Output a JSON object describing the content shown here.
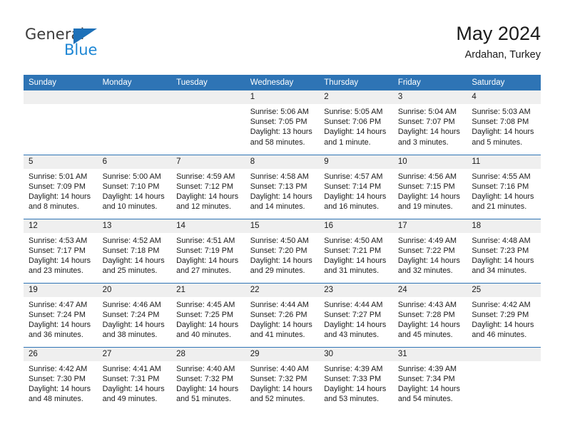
{
  "brand": {
    "name_top": "General",
    "name_bottom": "Blue",
    "triangle_icon": "triangle-icon",
    "accent_color": "#1d86d4"
  },
  "header": {
    "title": "May 2024",
    "subtitle": "Ardahan, Turkey"
  },
  "theme": {
    "header_blue": "#2e74b5",
    "daynum_band": "#efefef",
    "text": "#1a1a1a"
  },
  "weekday_headers": [
    "Sunday",
    "Monday",
    "Tuesday",
    "Wednesday",
    "Thursday",
    "Friday",
    "Saturday"
  ],
  "weeks": [
    [
      {
        "day": "",
        "empty": true
      },
      {
        "day": "",
        "empty": true
      },
      {
        "day": "",
        "empty": true
      },
      {
        "day": "1",
        "sunrise": "Sunrise: 5:06 AM",
        "sunset": "Sunset: 7:05 PM",
        "daylight_1": "Daylight: 13 hours",
        "daylight_2": "and 58 minutes."
      },
      {
        "day": "2",
        "sunrise": "Sunrise: 5:05 AM",
        "sunset": "Sunset: 7:06 PM",
        "daylight_1": "Daylight: 14 hours",
        "daylight_2": "and 1 minute."
      },
      {
        "day": "3",
        "sunrise": "Sunrise: 5:04 AM",
        "sunset": "Sunset: 7:07 PM",
        "daylight_1": "Daylight: 14 hours",
        "daylight_2": "and 3 minutes."
      },
      {
        "day": "4",
        "sunrise": "Sunrise: 5:03 AM",
        "sunset": "Sunset: 7:08 PM",
        "daylight_1": "Daylight: 14 hours",
        "daylight_2": "and 5 minutes."
      }
    ],
    [
      {
        "day": "5",
        "sunrise": "Sunrise: 5:01 AM",
        "sunset": "Sunset: 7:09 PM",
        "daylight_1": "Daylight: 14 hours",
        "daylight_2": "and 8 minutes."
      },
      {
        "day": "6",
        "sunrise": "Sunrise: 5:00 AM",
        "sunset": "Sunset: 7:10 PM",
        "daylight_1": "Daylight: 14 hours",
        "daylight_2": "and 10 minutes."
      },
      {
        "day": "7",
        "sunrise": "Sunrise: 4:59 AM",
        "sunset": "Sunset: 7:12 PM",
        "daylight_1": "Daylight: 14 hours",
        "daylight_2": "and 12 minutes."
      },
      {
        "day": "8",
        "sunrise": "Sunrise: 4:58 AM",
        "sunset": "Sunset: 7:13 PM",
        "daylight_1": "Daylight: 14 hours",
        "daylight_2": "and 14 minutes."
      },
      {
        "day": "9",
        "sunrise": "Sunrise: 4:57 AM",
        "sunset": "Sunset: 7:14 PM",
        "daylight_1": "Daylight: 14 hours",
        "daylight_2": "and 16 minutes."
      },
      {
        "day": "10",
        "sunrise": "Sunrise: 4:56 AM",
        "sunset": "Sunset: 7:15 PM",
        "daylight_1": "Daylight: 14 hours",
        "daylight_2": "and 19 minutes."
      },
      {
        "day": "11",
        "sunrise": "Sunrise: 4:55 AM",
        "sunset": "Sunset: 7:16 PM",
        "daylight_1": "Daylight: 14 hours",
        "daylight_2": "and 21 minutes."
      }
    ],
    [
      {
        "day": "12",
        "sunrise": "Sunrise: 4:53 AM",
        "sunset": "Sunset: 7:17 PM",
        "daylight_1": "Daylight: 14 hours",
        "daylight_2": "and 23 minutes."
      },
      {
        "day": "13",
        "sunrise": "Sunrise: 4:52 AM",
        "sunset": "Sunset: 7:18 PM",
        "daylight_1": "Daylight: 14 hours",
        "daylight_2": "and 25 minutes."
      },
      {
        "day": "14",
        "sunrise": "Sunrise: 4:51 AM",
        "sunset": "Sunset: 7:19 PM",
        "daylight_1": "Daylight: 14 hours",
        "daylight_2": "and 27 minutes."
      },
      {
        "day": "15",
        "sunrise": "Sunrise: 4:50 AM",
        "sunset": "Sunset: 7:20 PM",
        "daylight_1": "Daylight: 14 hours",
        "daylight_2": "and 29 minutes."
      },
      {
        "day": "16",
        "sunrise": "Sunrise: 4:50 AM",
        "sunset": "Sunset: 7:21 PM",
        "daylight_1": "Daylight: 14 hours",
        "daylight_2": "and 31 minutes."
      },
      {
        "day": "17",
        "sunrise": "Sunrise: 4:49 AM",
        "sunset": "Sunset: 7:22 PM",
        "daylight_1": "Daylight: 14 hours",
        "daylight_2": "and 32 minutes."
      },
      {
        "day": "18",
        "sunrise": "Sunrise: 4:48 AM",
        "sunset": "Sunset: 7:23 PM",
        "daylight_1": "Daylight: 14 hours",
        "daylight_2": "and 34 minutes."
      }
    ],
    [
      {
        "day": "19",
        "sunrise": "Sunrise: 4:47 AM",
        "sunset": "Sunset: 7:24 PM",
        "daylight_1": "Daylight: 14 hours",
        "daylight_2": "and 36 minutes."
      },
      {
        "day": "20",
        "sunrise": "Sunrise: 4:46 AM",
        "sunset": "Sunset: 7:24 PM",
        "daylight_1": "Daylight: 14 hours",
        "daylight_2": "and 38 minutes."
      },
      {
        "day": "21",
        "sunrise": "Sunrise: 4:45 AM",
        "sunset": "Sunset: 7:25 PM",
        "daylight_1": "Daylight: 14 hours",
        "daylight_2": "and 40 minutes."
      },
      {
        "day": "22",
        "sunrise": "Sunrise: 4:44 AM",
        "sunset": "Sunset: 7:26 PM",
        "daylight_1": "Daylight: 14 hours",
        "daylight_2": "and 41 minutes."
      },
      {
        "day": "23",
        "sunrise": "Sunrise: 4:44 AM",
        "sunset": "Sunset: 7:27 PM",
        "daylight_1": "Daylight: 14 hours",
        "daylight_2": "and 43 minutes."
      },
      {
        "day": "24",
        "sunrise": "Sunrise: 4:43 AM",
        "sunset": "Sunset: 7:28 PM",
        "daylight_1": "Daylight: 14 hours",
        "daylight_2": "and 45 minutes."
      },
      {
        "day": "25",
        "sunrise": "Sunrise: 4:42 AM",
        "sunset": "Sunset: 7:29 PM",
        "daylight_1": "Daylight: 14 hours",
        "daylight_2": "and 46 minutes."
      }
    ],
    [
      {
        "day": "26",
        "sunrise": "Sunrise: 4:42 AM",
        "sunset": "Sunset: 7:30 PM",
        "daylight_1": "Daylight: 14 hours",
        "daylight_2": "and 48 minutes."
      },
      {
        "day": "27",
        "sunrise": "Sunrise: 4:41 AM",
        "sunset": "Sunset: 7:31 PM",
        "daylight_1": "Daylight: 14 hours",
        "daylight_2": "and 49 minutes."
      },
      {
        "day": "28",
        "sunrise": "Sunrise: 4:40 AM",
        "sunset": "Sunset: 7:32 PM",
        "daylight_1": "Daylight: 14 hours",
        "daylight_2": "and 51 minutes."
      },
      {
        "day": "29",
        "sunrise": "Sunrise: 4:40 AM",
        "sunset": "Sunset: 7:32 PM",
        "daylight_1": "Daylight: 14 hours",
        "daylight_2": "and 52 minutes."
      },
      {
        "day": "30",
        "sunrise": "Sunrise: 4:39 AM",
        "sunset": "Sunset: 7:33 PM",
        "daylight_1": "Daylight: 14 hours",
        "daylight_2": "and 53 minutes."
      },
      {
        "day": "31",
        "sunrise": "Sunrise: 4:39 AM",
        "sunset": "Sunset: 7:34 PM",
        "daylight_1": "Daylight: 14 hours",
        "daylight_2": "and 54 minutes."
      },
      {
        "day": "",
        "empty": true
      }
    ]
  ]
}
